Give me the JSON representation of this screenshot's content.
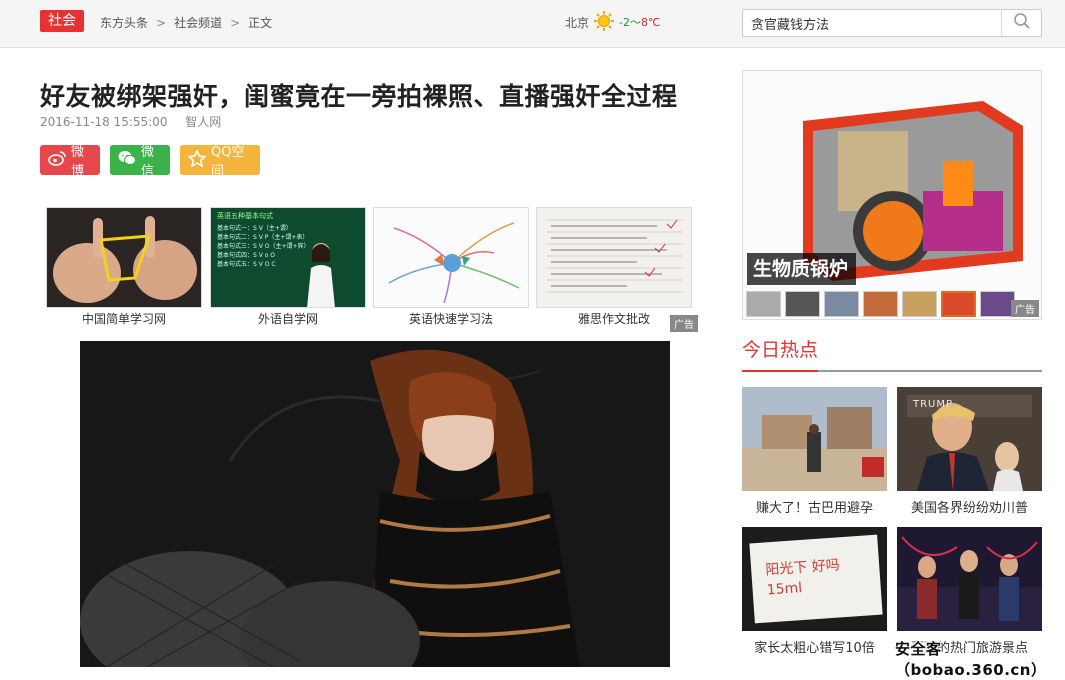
{
  "header": {
    "channel_badge": "社会",
    "breadcrumb": [
      "东方头条",
      "社会频道",
      "正文"
    ],
    "breadcrumb_sep": ">",
    "weather": {
      "city": "北京",
      "temp_low": "-2",
      "temp_sep": "～",
      "temp_high": "8℃",
      "icon": "sun-icon"
    },
    "search": {
      "value": "贪官藏钱方法",
      "placeholder": "",
      "icon": "search-icon"
    }
  },
  "article": {
    "title": "好友被绑架强奸，闺蜜竟在一旁拍裸照、直播强奸全过程",
    "date": "2016-11-18 15:55:00",
    "source": "智人网",
    "share": {
      "weibo": "微博",
      "wechat": "微信",
      "qzone": "QQ空间"
    }
  },
  "ad_strip": {
    "items": [
      {
        "label": "中国简单学习网"
      },
      {
        "label": "外语自学网"
      },
      {
        "label": "英语快速学习法"
      },
      {
        "label": "雅思作文批改"
      }
    ],
    "tag": "广告",
    "lesson_title": "英语五种基本句式",
    "lesson_lines": [
      "基本句式一：S V（主+谓）",
      "基本句式二：S V P（主+谓+表）",
      "基本句式三：S V O（主+谓+宾）",
      "基本句式四：S V o O",
      "基本句式五：S V O C"
    ]
  },
  "sidebar": {
    "ad_caption": "生物质锅炉",
    "ad_tag": "广告",
    "hot_title": "今日热点",
    "hot_items": [
      {
        "caption": "赚大了！古巴用避孕"
      },
      {
        "caption": "美国各界纷纷劝川普"
      },
      {
        "caption": "家长太粗心错写10倍"
      },
      {
        "caption": "蔓延的热门旅游景点"
      }
    ],
    "handwriting": "阳光下 好吗 15ml",
    "trump_sign": "TRUMP"
  },
  "watermark": "安全客（bobao.360.cn）",
  "colors": {
    "accent": "#e53333",
    "weibo": "#e5474b",
    "wechat": "#3bb24a",
    "qzone": "#f5b43b"
  }
}
